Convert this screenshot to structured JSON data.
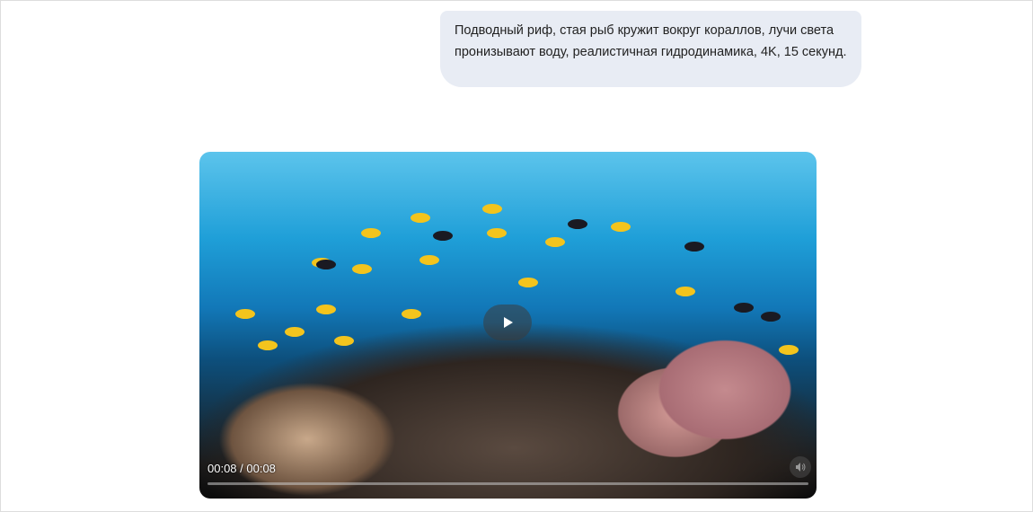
{
  "message": {
    "text": "Подводный риф, стая рыб кружит вокруг кораллов, лучи света пронизывают воду, реалистичная гидродинамика, 4K, 15 секунд."
  },
  "video": {
    "time_display": "00:08 / 00:08",
    "progress_fraction": 1.0,
    "play_icon": "play-icon",
    "volume_icon": "volume-icon"
  }
}
